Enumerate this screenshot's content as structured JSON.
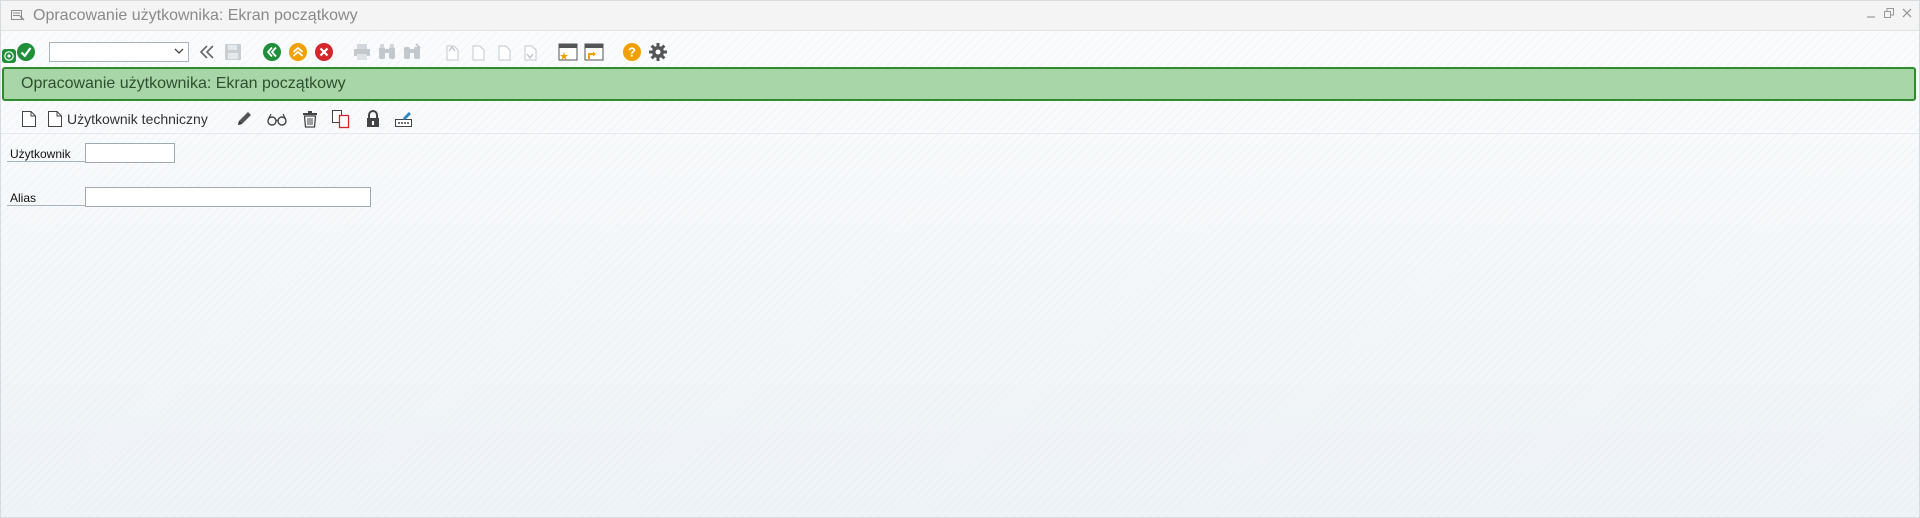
{
  "window": {
    "title": "Opracowanie użytkownika: Ekran początkowy"
  },
  "system_toolbar": {
    "command_field_value": "",
    "icons": [
      "sap-status-icon",
      "enter-check-icon",
      "command-dropdown",
      "collapse-icon",
      "save-icon",
      "back-icon",
      "exit-icon",
      "cancel-icon",
      "print-icon",
      "find-icon",
      "find-next-icon",
      "first-page-icon",
      "previous-page-icon",
      "next-page-icon",
      "last-page-icon",
      "create-session-icon",
      "create-shortcut-icon",
      "help-icon",
      "settings-icon"
    ],
    "colors": {
      "back": "#1f8f3a",
      "exit": "#f0a000",
      "cancel": "#d4262b",
      "help": "#f0a000"
    }
  },
  "header": {
    "title": "Opracowanie użytkownika: Ekran początkowy",
    "color": "#a8d6a8",
    "border_color": "#2e8b2e"
  },
  "app_toolbar": {
    "technical_user_label": "Użytkownik techniczny",
    "icons": [
      "create-document-icon",
      "technical-user-document-icon",
      "change-pencil-icon",
      "display-glasses-icon",
      "delete-trash-icon",
      "copy-icon",
      "lock-icon",
      "change-password-icon"
    ]
  },
  "form": {
    "user_label": "Użytkownik",
    "user_value": "",
    "alias_label": "Alias",
    "alias_value": ""
  }
}
